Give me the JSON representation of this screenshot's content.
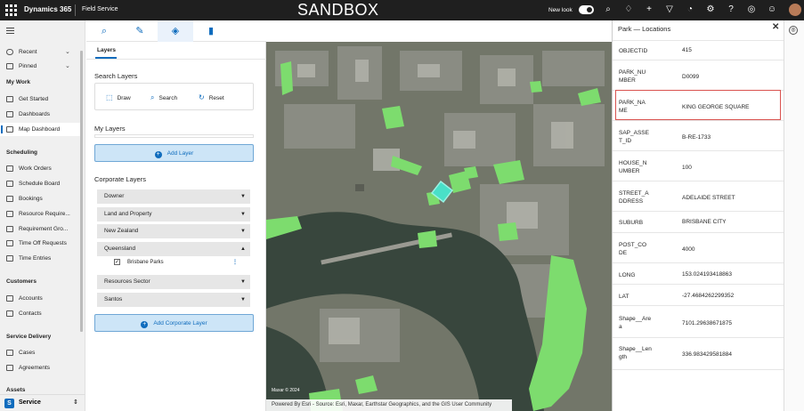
{
  "topbar": {
    "app_name": "Dynamics 365",
    "area": "Field Service",
    "environment": "SANDBOX",
    "new_look_label": "New look",
    "icons": [
      "search-icon",
      "lightbulb-icon",
      "plus-icon",
      "filter-icon",
      "bell-icon",
      "gear-icon",
      "help-icon",
      "copilot-icon",
      "smiley-icon"
    ]
  },
  "nav": {
    "items": [
      {
        "label": "Recent",
        "icon": "clock-icon",
        "chevron": "⌄"
      },
      {
        "label": "Pinned",
        "icon": "pin-icon",
        "chevron": "⌄"
      }
    ],
    "sections": [
      {
        "title": "My Work",
        "items": [
          {
            "label": "Get Started",
            "icon": "play-icon"
          },
          {
            "label": "Dashboards",
            "icon": "dashboard-icon"
          },
          {
            "label": "Map Dashboard",
            "icon": "map-icon",
            "selected": true
          }
        ]
      },
      {
        "title": "Scheduling",
        "items": [
          {
            "label": "Work Orders",
            "icon": "work-order-icon"
          },
          {
            "label": "Schedule Board",
            "icon": "board-icon"
          },
          {
            "label": "Bookings",
            "icon": "booking-icon"
          },
          {
            "label": "Resource Require...",
            "icon": "requirement-icon"
          },
          {
            "label": "Requirement Gro...",
            "icon": "group-icon"
          },
          {
            "label": "Time Off Requests",
            "icon": "time-off-icon"
          },
          {
            "label": "Time Entries",
            "icon": "time-entry-icon"
          }
        ]
      },
      {
        "title": "Customers",
        "items": [
          {
            "label": "Accounts",
            "icon": "account-icon"
          },
          {
            "label": "Contacts",
            "icon": "contact-icon"
          }
        ]
      },
      {
        "title": "Service Delivery",
        "items": [
          {
            "label": "Cases",
            "icon": "case-icon"
          },
          {
            "label": "Agreements",
            "icon": "agreement-icon"
          }
        ]
      },
      {
        "title": "Assets",
        "items": []
      }
    ],
    "area_switcher": {
      "badge": "S",
      "label": "Service",
      "chevron": "⇕"
    }
  },
  "tools": {
    "icons": [
      "search-icon",
      "pencil-icon",
      "layers-icon",
      "bookmark-icon"
    ]
  },
  "panel": {
    "tab": "Layers",
    "search_layers_title": "Search Layers",
    "draw_label": "Draw",
    "search_label": "Search",
    "reset_label": "Reset",
    "my_layers_title": "My Layers",
    "add_layer_label": "Add Layer",
    "corporate_layers_title": "Corporate Layers",
    "corporate_layers": [
      {
        "name": "Downer",
        "expanded": false
      },
      {
        "name": "Land and Property",
        "expanded": false
      },
      {
        "name": "New Zealand",
        "expanded": false
      },
      {
        "name": "Queensland",
        "expanded": true
      },
      {
        "name": "Resources Sector",
        "expanded": false
      },
      {
        "name": "Santos",
        "expanded": false
      }
    ],
    "sublayer": {
      "name": "Brisbane Parks",
      "checked": true
    },
    "add_corporate_layer_label": "Add Corporate Layer"
  },
  "map": {
    "attribution": "Powered By Esri - Source: Esri, Maxar, Earthstar Geographics, and the GIS User Community",
    "copyright": "Maxar © 2024",
    "park_color": "#7ddc6e",
    "selected_color": "#49e0c8"
  },
  "properties": {
    "title": "Park — Locations",
    "close": "✕",
    "rows": [
      {
        "key": "OBJECTID",
        "value": "415"
      },
      {
        "key": "PARK_NUMBER",
        "value": "D0099"
      },
      {
        "key": "PARK_NAME",
        "value": "KING GEORGE SQUARE",
        "highlighted": true
      },
      {
        "key": "SAP_ASSET_ID",
        "value": "B-RE-1733"
      },
      {
        "key": "HOUSE_NUMBER",
        "value": "100"
      },
      {
        "key": "STREET_ADDRESS",
        "value": "ADELAIDE STREET"
      },
      {
        "key": "SUBURB",
        "value": "BRISBANE CITY"
      },
      {
        "key": "POST_CODE",
        "value": "4000"
      },
      {
        "key": "LONG",
        "value": "153.024193418863"
      },
      {
        "key": "LAT",
        "value": "-27.4684262299352"
      },
      {
        "key": "Shape__Area",
        "value": "7101.29638671875"
      },
      {
        "key": "Shape__Length",
        "value": "336.983429581884"
      }
    ]
  }
}
